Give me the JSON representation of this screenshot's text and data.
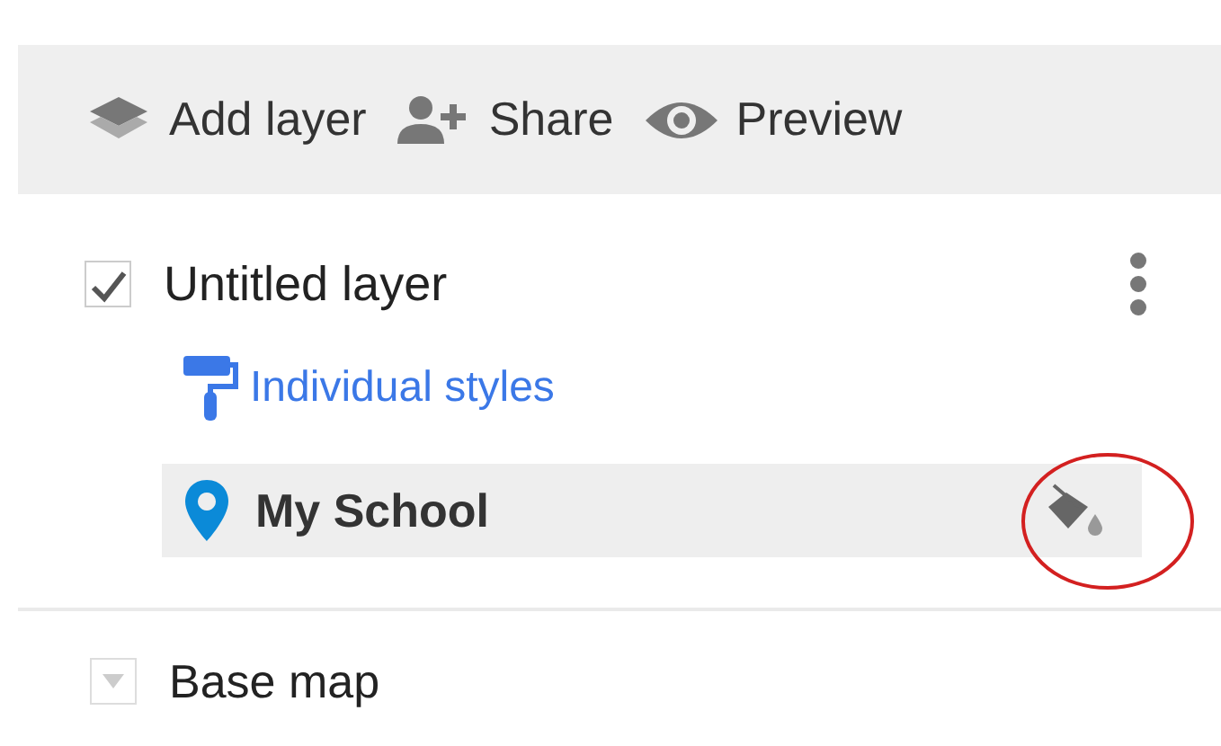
{
  "toolbar": [
    {
      "kind": "layers",
      "label": "Add layer"
    },
    {
      "kind": "person-add",
      "label": "Share"
    },
    {
      "kind": "eye",
      "label": "Preview"
    }
  ],
  "layer": {
    "name": "Untitled layer",
    "checked": true,
    "style_link": "Individual styles",
    "features": [
      {
        "name": "My School",
        "highlighted": true
      }
    ]
  },
  "base_map": {
    "label": "Base map",
    "expanded": false
  }
}
